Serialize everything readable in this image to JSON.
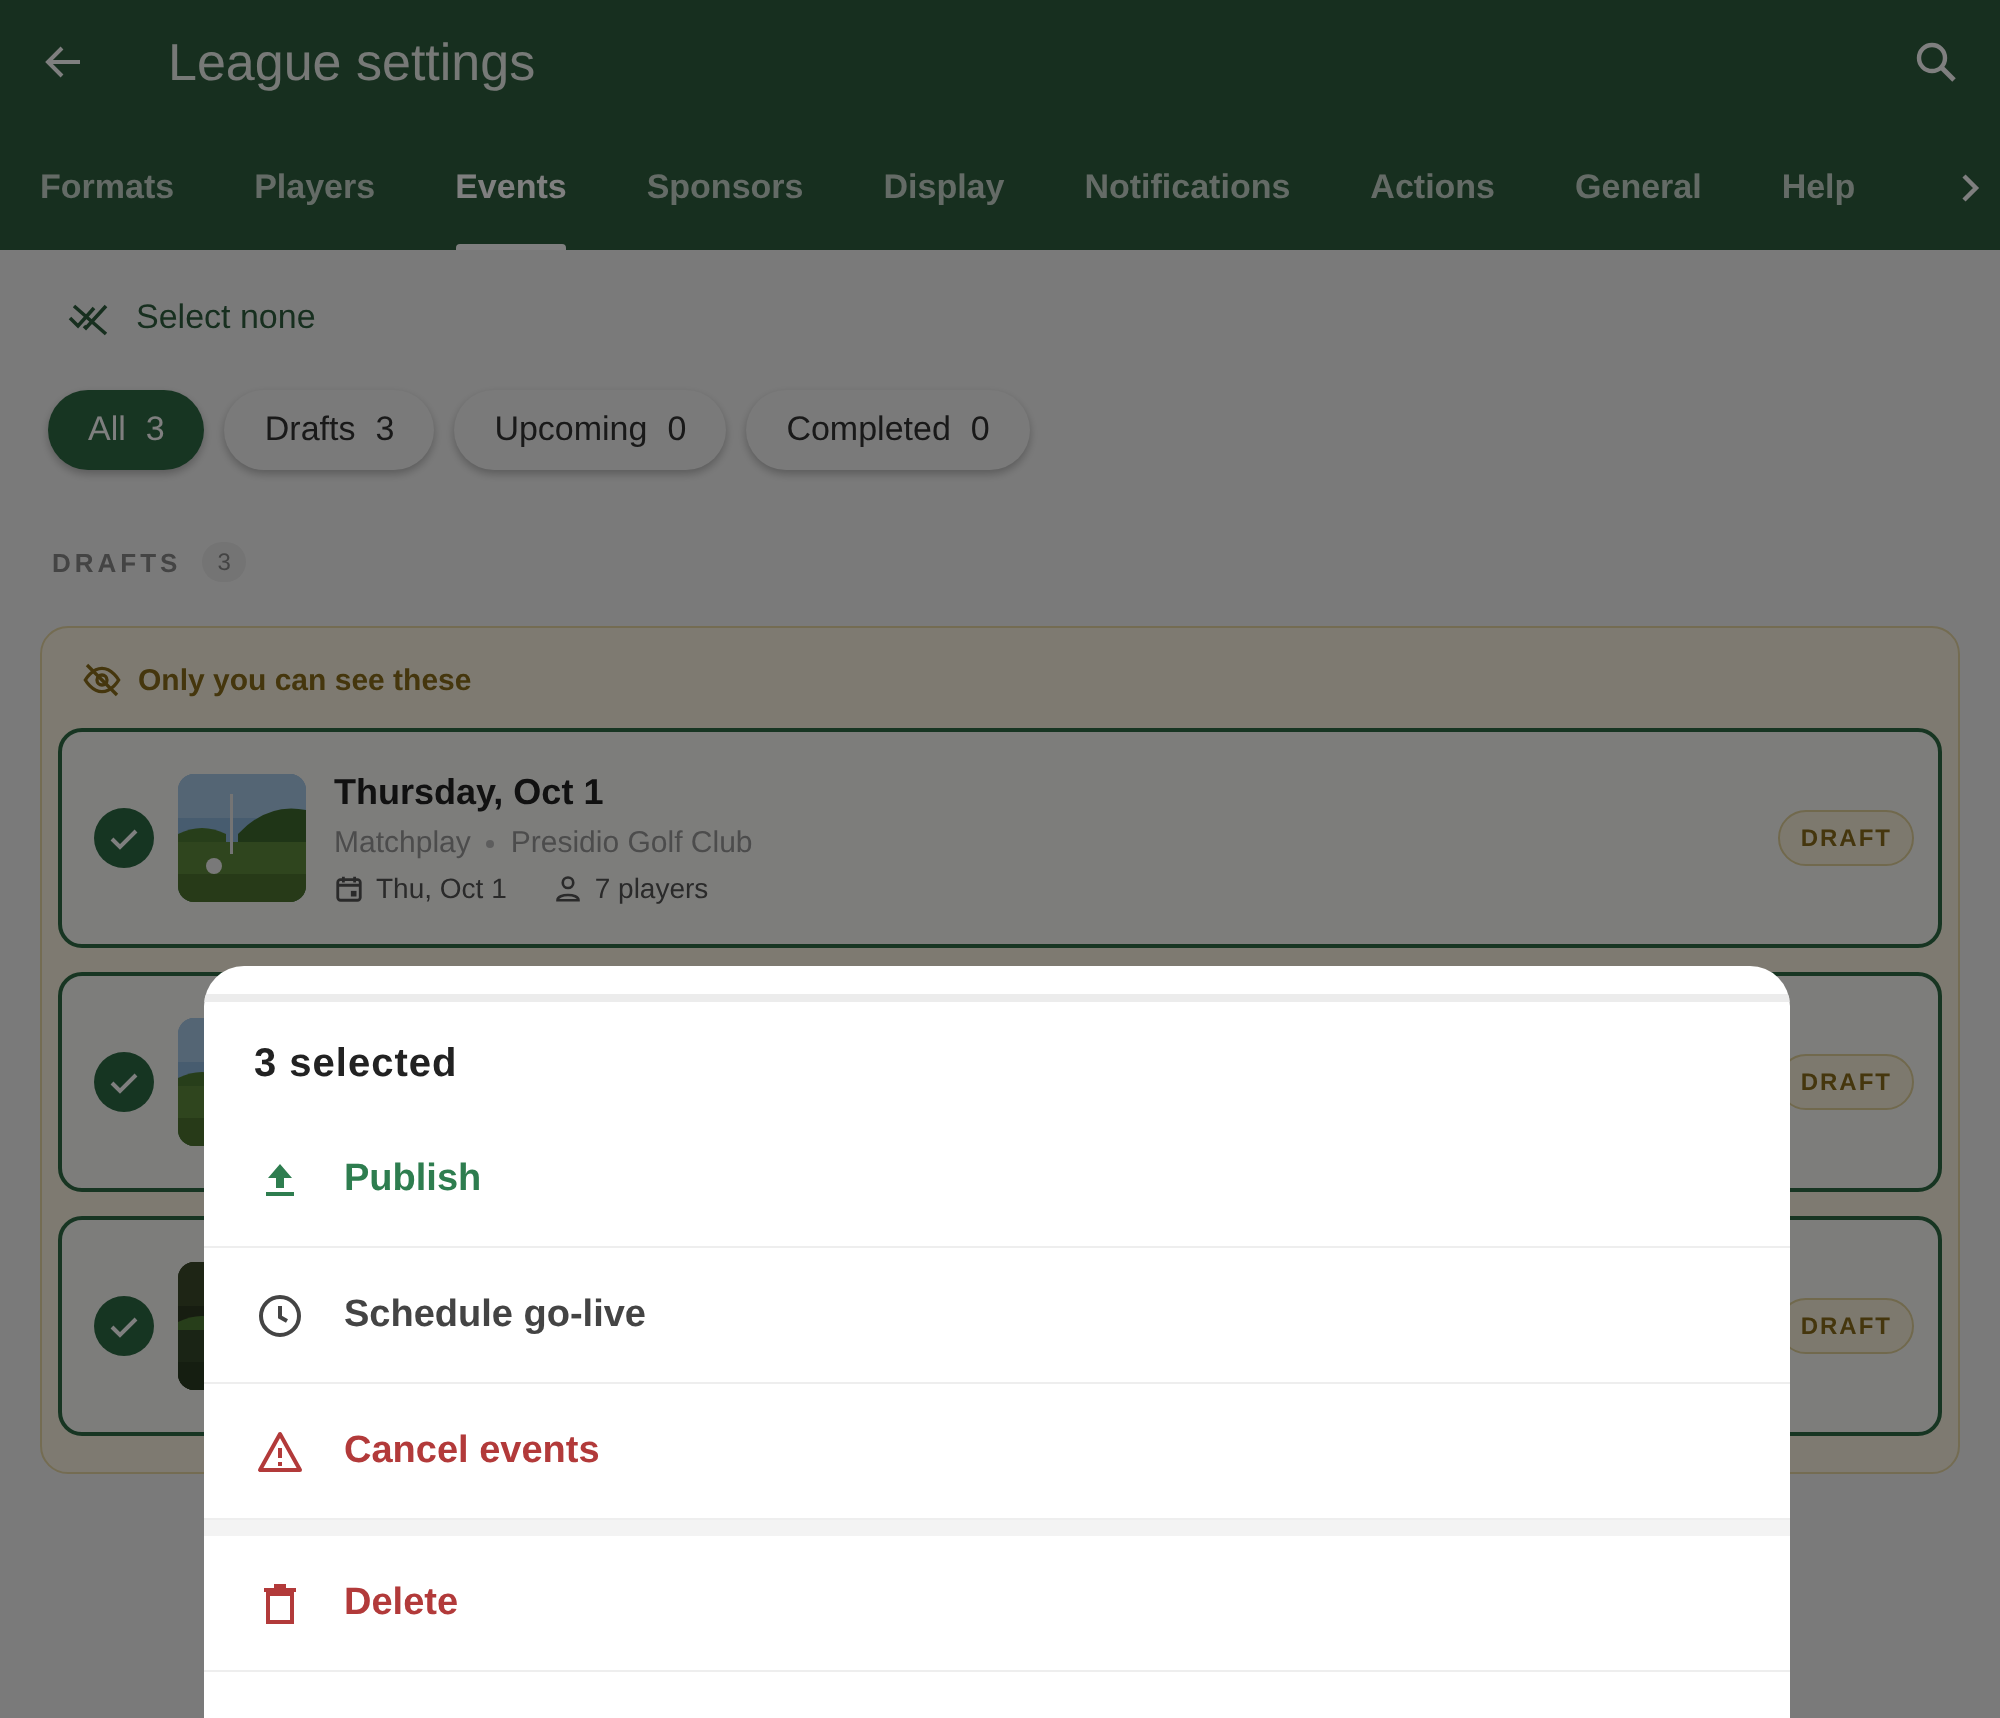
{
  "app_bar": {
    "title": "League settings"
  },
  "tabs": [
    {
      "label": "Formats",
      "selected": false
    },
    {
      "label": "Players",
      "selected": false
    },
    {
      "label": "Events",
      "selected": true
    },
    {
      "label": "Sponsors",
      "selected": false
    },
    {
      "label": "Display",
      "selected": false
    },
    {
      "label": "Notifications",
      "selected": false
    },
    {
      "label": "Actions",
      "selected": false
    },
    {
      "label": "General",
      "selected": false
    },
    {
      "label": "Help",
      "selected": false
    }
  ],
  "select_none": "Select none",
  "filters": [
    {
      "label": "All",
      "count": "3",
      "selected": true
    },
    {
      "label": "Drafts",
      "count": "3",
      "selected": false
    },
    {
      "label": "Upcoming",
      "count": "0",
      "selected": false
    },
    {
      "label": "Completed",
      "count": "0",
      "selected": false
    }
  ],
  "section": {
    "label": "DRAFTS",
    "count": "3"
  },
  "notice": "Only you can see these",
  "events": [
    {
      "selected": true,
      "title": "Thursday, Oct 1",
      "format": "Matchplay",
      "course": "Presidio Golf Club",
      "date": "Thu, Oct 1",
      "players": "7 players",
      "badge": "DRAFT"
    },
    {
      "selected": true,
      "badge": "DRAFT"
    },
    {
      "selected": true,
      "badge": "DRAFT"
    }
  ],
  "sheet": {
    "title": "3 selected",
    "groups": [
      [
        {
          "label": "Publish",
          "kind": "positive"
        },
        {
          "label": "Schedule go-live",
          "kind": "neutral"
        },
        {
          "label": "Cancel events",
          "kind": "warning"
        }
      ],
      [
        {
          "label": "Delete",
          "kind": "delete"
        }
      ]
    ]
  }
}
